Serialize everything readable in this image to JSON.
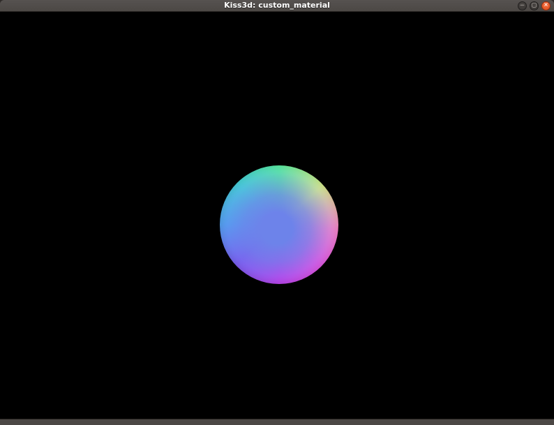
{
  "window": {
    "title": "Kiss3d: custom_material",
    "controls": {
      "minimize_label": "─",
      "maximize_label": "▢",
      "close_label": "✕"
    }
  },
  "theme": {
    "titlebar_bg": "#4c4845",
    "titlebar_bg_light": "#565250",
    "titlebar_text": "#ffffff",
    "control_btn_bg": "#353230",
    "close_btn_bg": "#de4815",
    "viewport_bg": "#000000"
  },
  "scene": {
    "object": "normal-mapped-sphere",
    "sphere_colors": {
      "top": "#5af2a2",
      "top_right": "#d9ee8e",
      "right": "#ff85c8",
      "bottom_right": "#f153e3",
      "bottom": "#cf35ee",
      "bottom_left": "#7e55f2",
      "left": "#4fa6f2",
      "top_left": "#43d8d8",
      "center": "#6d83ea"
    }
  }
}
